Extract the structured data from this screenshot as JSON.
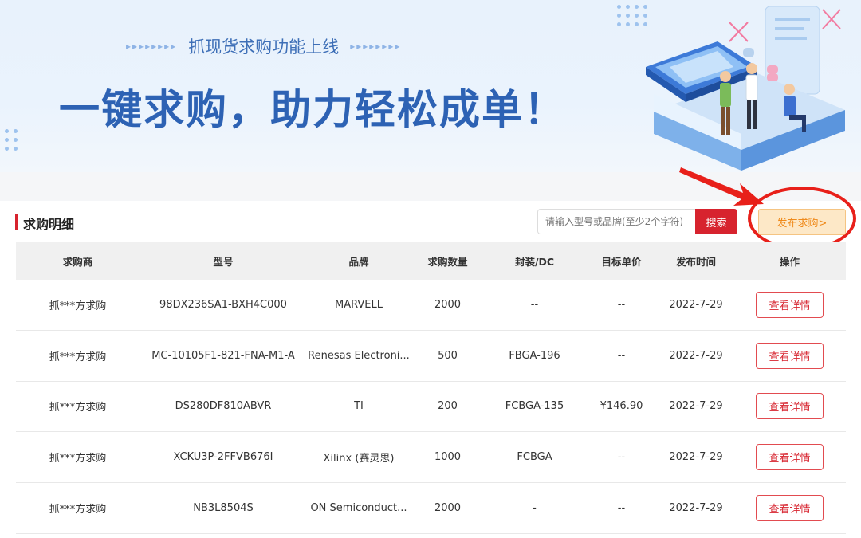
{
  "banner": {
    "subtitle": "抓现货求购功能上线",
    "arrows_left": "▸▸▸▸▸▸▸▸",
    "arrows_right": "▸▸▸▸▸▸▸▸",
    "headline": "一键求购，助力轻松成单！"
  },
  "section": {
    "title": "求购明细",
    "search_placeholder": "请输入型号或品牌(至少2个字符)",
    "search_button": "搜索",
    "publish_button": "发布求购>"
  },
  "table": {
    "headers": [
      "求购商",
      "型号",
      "品牌",
      "求购数量",
      "封装/DC",
      "目标单价",
      "发布时间",
      "操作"
    ],
    "rows": [
      {
        "buyer": "抓***方求购",
        "model": "98DX236SA1-BXH4C000",
        "brand": "MARVELL",
        "qty": "2000",
        "package": "--",
        "price": "--",
        "date": "2022-7-29",
        "action": "查看详情"
      },
      {
        "buyer": "抓***方求购",
        "model": "MC-10105F1-821-FNA-M1-A",
        "brand": "Renesas Electroni...",
        "qty": "500",
        "package": "FBGA-196",
        "price": "--",
        "date": "2022-7-29",
        "action": "查看详情"
      },
      {
        "buyer": "抓***方求购",
        "model": "DS280DF810ABVR",
        "brand": "TI",
        "qty": "200",
        "package": "FCBGA-135",
        "price": "¥146.90",
        "date": "2022-7-29",
        "action": "查看详情"
      },
      {
        "buyer": "抓***方求购",
        "model": "XCKU3P-2FFVB676I",
        "brand": "Xilinx (赛灵思)",
        "qty": "1000",
        "package": "FCBGA",
        "price": "--",
        "date": "2022-7-29",
        "action": "查看详情"
      },
      {
        "buyer": "抓***方求购",
        "model": "NB3L8504S",
        "brand": "ON Semiconduct...",
        "qty": "2000",
        "package": "-",
        "price": "--",
        "date": "2022-7-29",
        "action": "查看详情"
      }
    ]
  },
  "colors": {
    "accent_red": "#d7232e",
    "publish_bg": "#fde8c7",
    "publish_text": "#ef8a1b",
    "headline_blue": "#2d62b4"
  }
}
